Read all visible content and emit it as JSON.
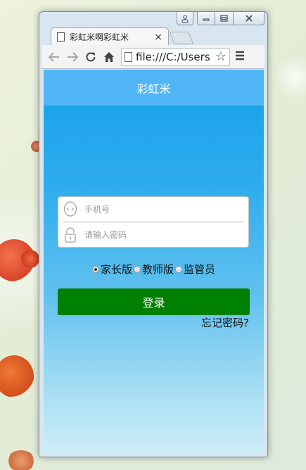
{
  "window": {
    "tab_title": "彩虹米啊彩虹米",
    "tab_close": "×",
    "address": "file:///C:/Users"
  },
  "app": {
    "header_title": "彩虹米",
    "phone_placeholder": "手机号",
    "password_placeholder": "请输入密码",
    "roles": [
      {
        "label": "家长版",
        "checked": true
      },
      {
        "label": "教师版",
        "checked": false
      },
      {
        "label": "监管员",
        "checked": false
      }
    ],
    "login_label": "登录",
    "forgot_label": "忘记密码?"
  },
  "colors": {
    "header": "#51b6f6",
    "login_button": "#008000"
  }
}
